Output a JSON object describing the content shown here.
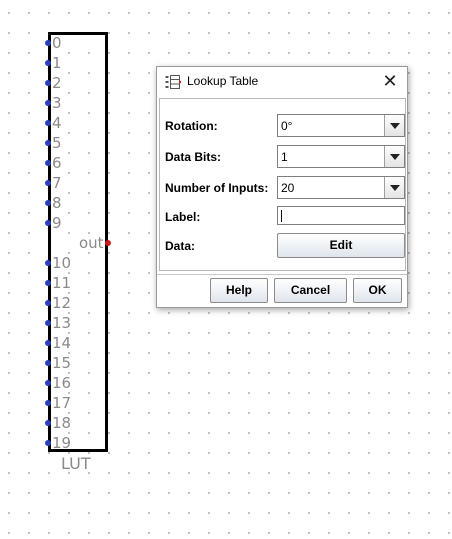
{
  "canvas": {
    "component": {
      "input_pins": [
        "0",
        "1",
        "2",
        "3",
        "4",
        "5",
        "6",
        "7",
        "8",
        "9",
        "10",
        "11",
        "12",
        "13",
        "14",
        "15",
        "16",
        "17",
        "18",
        "19"
      ],
      "output_label": "out",
      "caption": "LUT",
      "colors": {
        "input_pin": "#2a3cbf",
        "output_pin": "#c81c1c",
        "outline": "#000000",
        "label_text": "#8a8a8a"
      }
    }
  },
  "dialog": {
    "title": "Lookup Table",
    "close_icon": "close-icon",
    "title_icon": "lookup-table-icon",
    "fields": {
      "rotation": {
        "label": "Rotation:",
        "value": "0°"
      },
      "data_bits": {
        "label": "Data Bits:",
        "value": "1"
      },
      "num_inputs": {
        "label": "Number of Inputs:",
        "value": "20"
      },
      "label": {
        "label": "Label:",
        "value": ""
      },
      "data": {
        "label": "Data:",
        "button": "Edit"
      }
    },
    "buttons": {
      "help": "Help",
      "cancel": "Cancel",
      "ok": "OK"
    }
  }
}
